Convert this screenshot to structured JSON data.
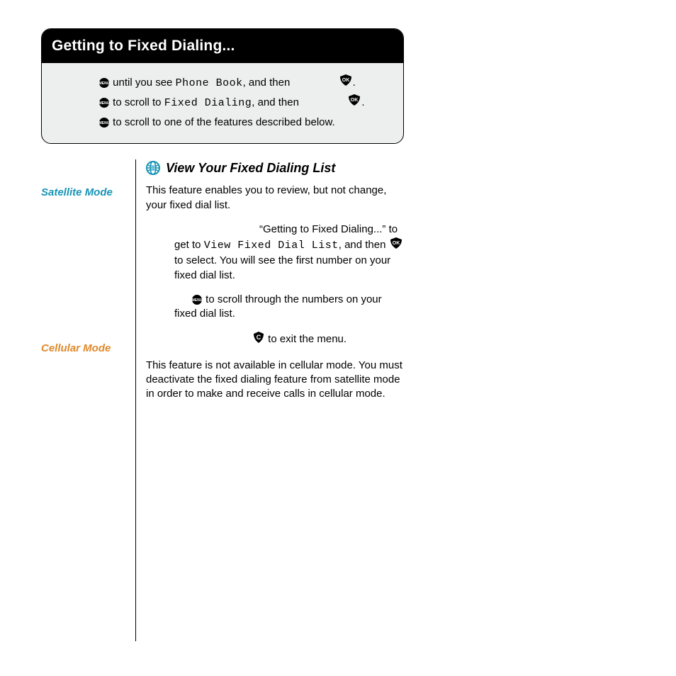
{
  "header": {
    "title": "Getting to Fixed Dialing...",
    "steps": {
      "s1a": " until you see ",
      "s1b": "Phone Book",
      "s1c": ", and then ",
      "s1d": ".",
      "s2a": " to scroll to ",
      "s2b": "Fixed Dialing",
      "s2c": ", and then ",
      "s2d": ".",
      "s3a": " to scroll to one of the features described below."
    }
  },
  "section": {
    "title": "View Your Fixed Dialing List"
  },
  "modes": {
    "satellite_label": "Satellite Mode",
    "cellular_label": "Cellular Mode"
  },
  "satellite": {
    "p1": "This feature enables you to review, but not change, your fixed dial list.",
    "p2a": "“Getting to Fixed Dialing...” to get to ",
    "p2b": "View Fixed Dial List",
    "p2c": ", and then ",
    "p2d": " to select. You will see the first number on your fixed dial list.",
    "p3a": " to scroll through the numbers on your fixed dial list.",
    "p4a": " to exit the menu."
  },
  "cellular": {
    "p1": "This feature is not available in cellular mode. You must deactivate the fixed dialing feature from satellite mode in order to make and receive calls in cellular mode."
  }
}
